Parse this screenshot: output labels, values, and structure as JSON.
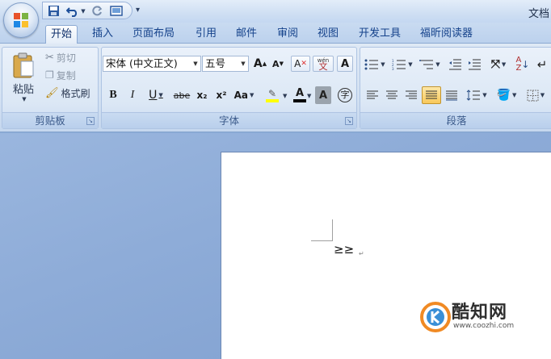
{
  "window": {
    "title": "文档"
  },
  "quick_access": {
    "items": [
      "save-icon",
      "undo-icon",
      "redo-icon",
      "print-preview-icon"
    ],
    "customize_label": "▾"
  },
  "tabs": [
    {
      "label": "开始",
      "active": true
    },
    {
      "label": "插入",
      "active": false
    },
    {
      "label": "页面布局",
      "active": false
    },
    {
      "label": "引用",
      "active": false
    },
    {
      "label": "邮件",
      "active": false
    },
    {
      "label": "审阅",
      "active": false
    },
    {
      "label": "视图",
      "active": false
    },
    {
      "label": "开发工具",
      "active": false
    },
    {
      "label": "福昕阅读器",
      "active": false
    }
  ],
  "clipboard": {
    "group_label": "剪贴板",
    "paste_label": "粘贴",
    "cut_label": "剪切",
    "copy_label": "复制",
    "format_painter_label": "格式刷"
  },
  "font": {
    "group_label": "字体",
    "font_name": "宋体 (中文正文)",
    "font_size": "五号",
    "grow_label": "A",
    "shrink_label": "A",
    "clear_label": "A",
    "phonetic_label": "wén",
    "border_label": "A",
    "bold_label": "B",
    "italic_label": "I",
    "underline_label": "U",
    "strike_label": "abe",
    "subscript_label": "x₂",
    "superscript_label": "x²",
    "case_label": "Aa",
    "font_color_label": "A",
    "shading_label": "A",
    "enclose_label": "字",
    "highlight_color": "#ffff00",
    "font_color": "#000000"
  },
  "paragraph": {
    "group_label": "段落"
  },
  "document": {
    "text": "≥≥",
    "para_mark": "↵"
  },
  "watermark": {
    "name": "酷知网",
    "url": "www.coozhi.com"
  }
}
